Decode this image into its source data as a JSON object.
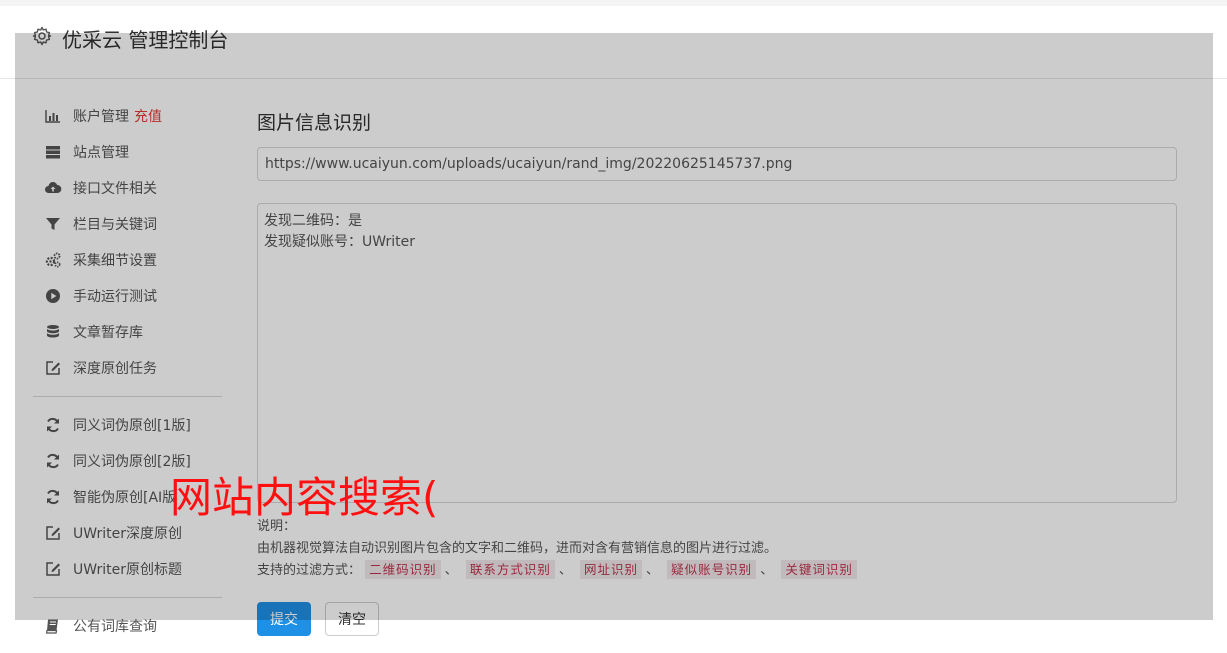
{
  "app": {
    "title": "优采云 管理控制台"
  },
  "sidebar": {
    "items": [
      {
        "label": "账户管理",
        "extra": "充值",
        "icon": "bar-chart-icon"
      },
      {
        "label": "站点管理",
        "icon": "server-icon"
      },
      {
        "label": "接口文件相关",
        "icon": "cloud-upload-icon"
      },
      {
        "label": "栏目与关键词",
        "icon": "filter-icon"
      },
      {
        "label": "采集细节设置",
        "icon": "gears-icon"
      },
      {
        "label": "手动运行测试",
        "icon": "play-circle-icon"
      },
      {
        "label": "文章暂存库",
        "icon": "database-icon"
      },
      {
        "label": "深度原创任务",
        "icon": "edit-icon"
      },
      {
        "label": "同义词伪原创[1版]",
        "icon": "refresh-icon"
      },
      {
        "label": "同义词伪原创[2版]",
        "icon": "refresh-icon"
      },
      {
        "label": "智能伪原创[AI版",
        "icon": "refresh-icon"
      },
      {
        "label": "UWriter深度原创",
        "icon": "edit-icon"
      },
      {
        "label": "UWriter原创标题",
        "icon": "edit-icon"
      },
      {
        "label": "公有词库查询",
        "icon": "book-icon"
      }
    ]
  },
  "main": {
    "title": "图片信息识别",
    "url_value": "https://www.ucaiyun.com/uploads/ucaiyun/rand_img/20220625145737.png",
    "result_lines": [
      "发现二维码：是",
      "发现疑似账号：UWriter"
    ],
    "notes": {
      "heading": "说明：",
      "description": "由机器视觉算法自动识别图片包含的文字和二维码，进而对含有营销信息的图片进行过滤。",
      "filter_label": "支持的过滤方式：",
      "tags": [
        "二维码识别",
        "联系方式识别",
        "网址识别",
        "疑似账号识别",
        "关键词识别"
      ],
      "separator": "、"
    },
    "buttons": {
      "submit": "提交",
      "clear": "清空"
    }
  },
  "overlay_text": "网站内容搜索(",
  "colors": {
    "accent": "#1e90e6",
    "recharge": "#e53935",
    "tag_text": "#c0334d",
    "overlay_text": "#ff1010"
  }
}
